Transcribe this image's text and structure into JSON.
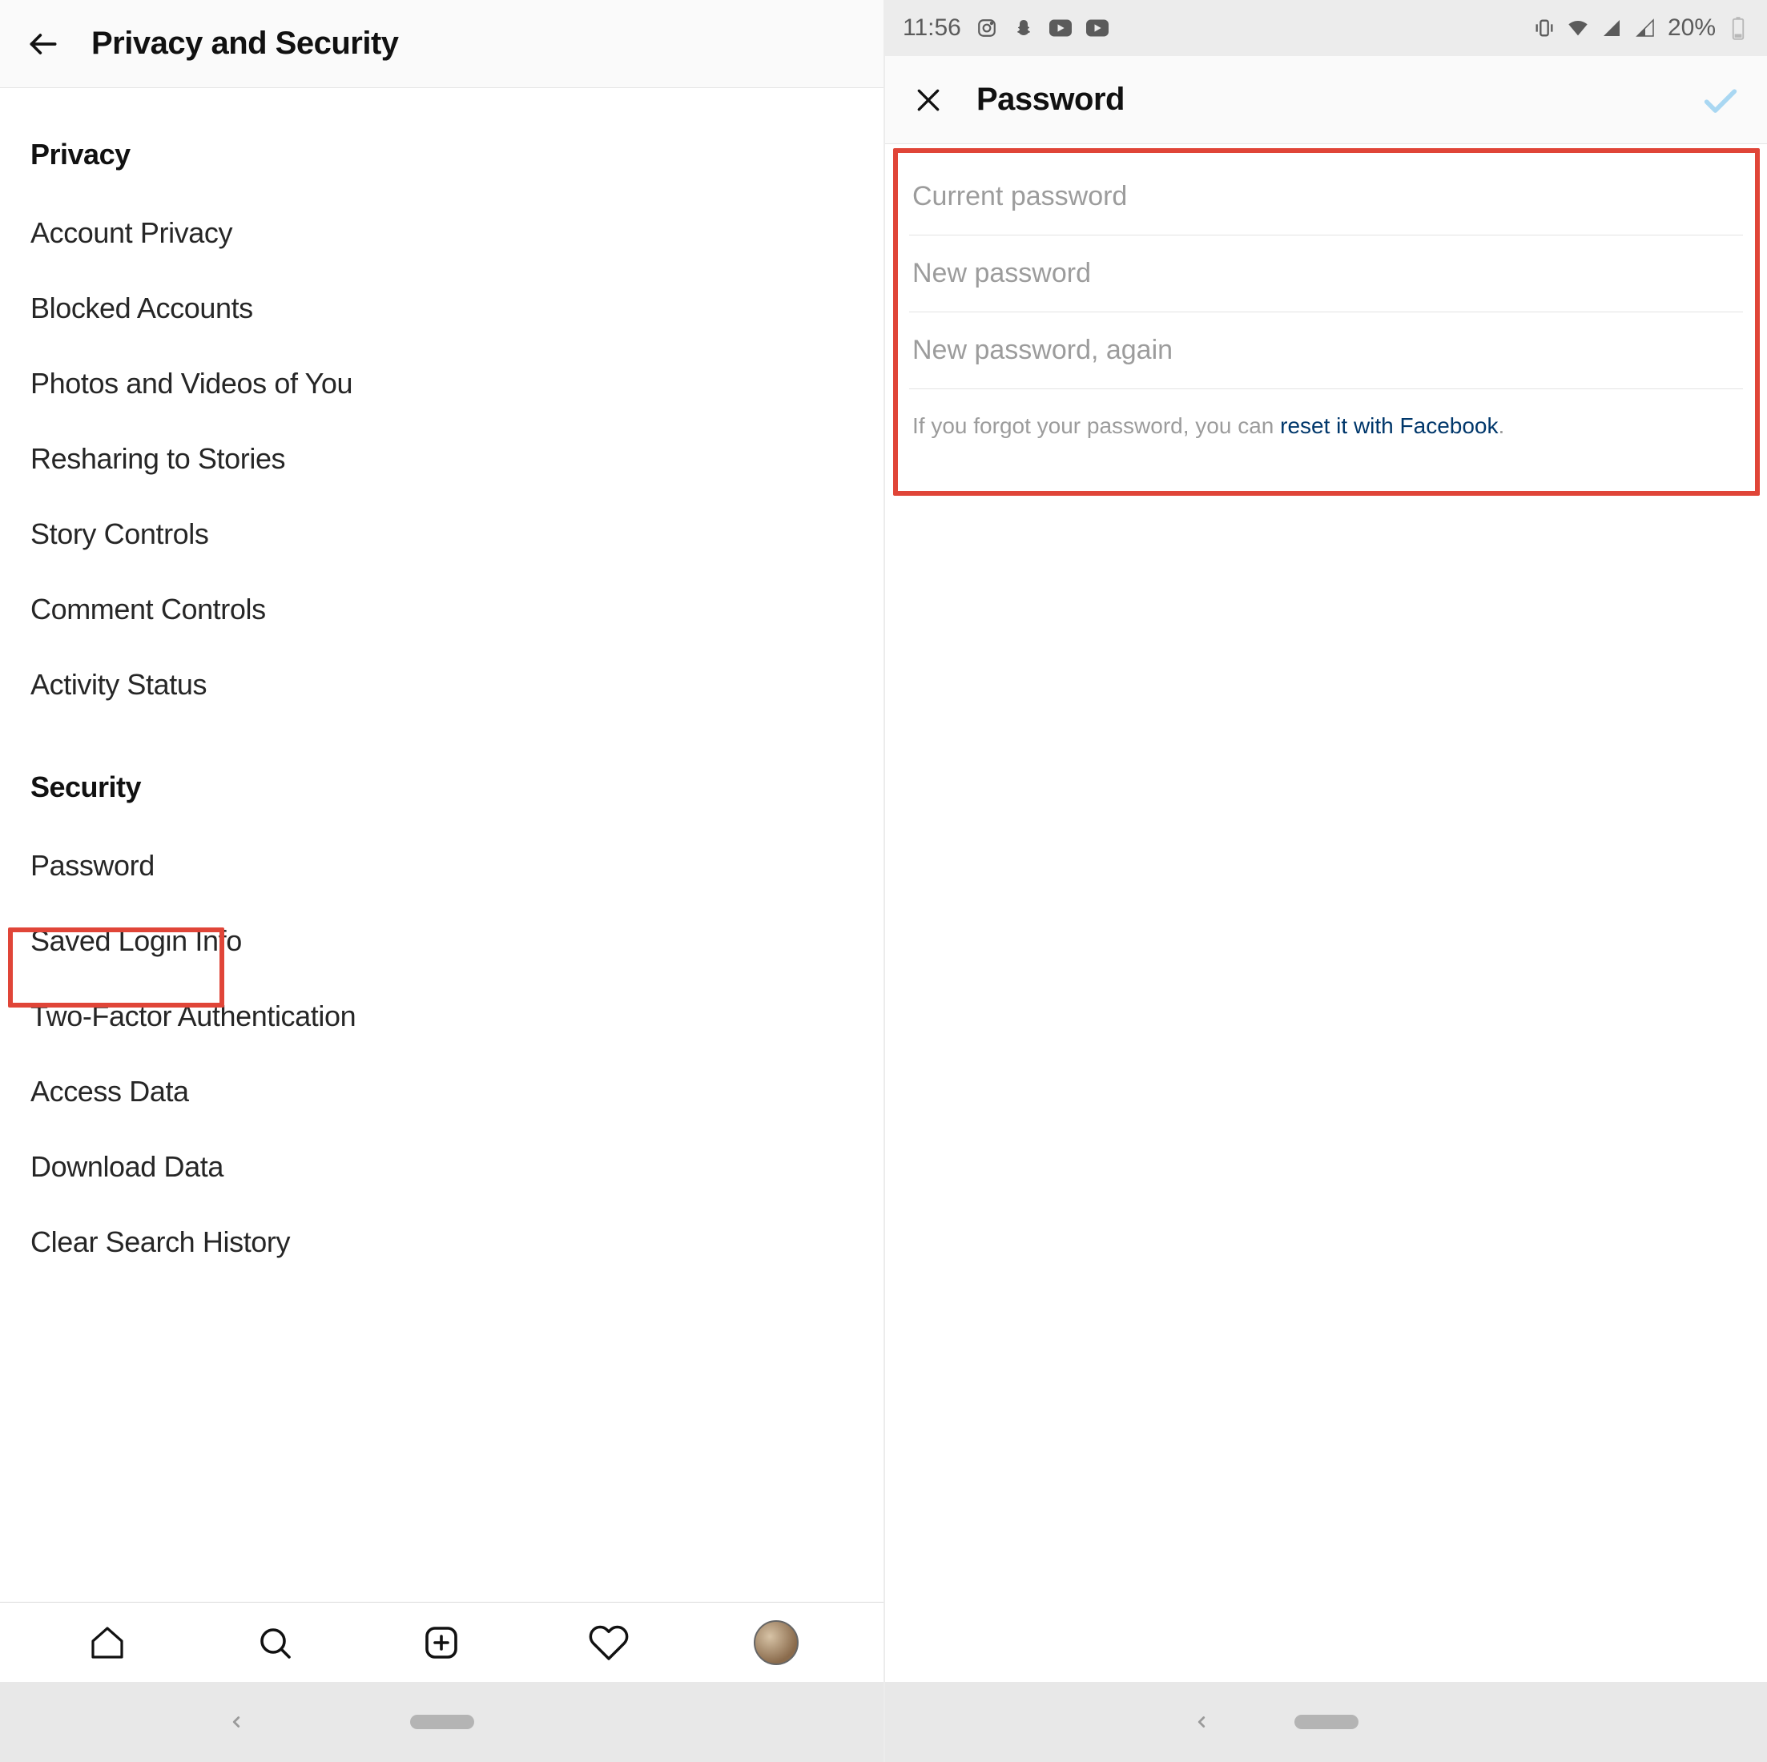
{
  "left": {
    "header": {
      "title": "Privacy and Security"
    },
    "sections": {
      "privacy": {
        "label": "Privacy",
        "items": [
          "Account Privacy",
          "Blocked Accounts",
          "Photos and Videos of You",
          "Resharing to Stories",
          "Story Controls",
          "Comment Controls",
          "Activity Status"
        ]
      },
      "security": {
        "label": "Security",
        "items": [
          "Password",
          "Saved Login Info",
          "Two-Factor Authentication",
          "Access Data",
          "Download Data",
          "Clear Search History"
        ]
      }
    }
  },
  "right": {
    "status": {
      "time": "11:56",
      "battery": "20%"
    },
    "header": {
      "title": "Password"
    },
    "fields": {
      "current_placeholder": "Current password",
      "new_placeholder": "New password",
      "new_again_placeholder": "New password, again"
    },
    "helper": {
      "prefix": "If you forgot your password, you can ",
      "link": "reset it with Facebook",
      "suffix": "."
    }
  }
}
